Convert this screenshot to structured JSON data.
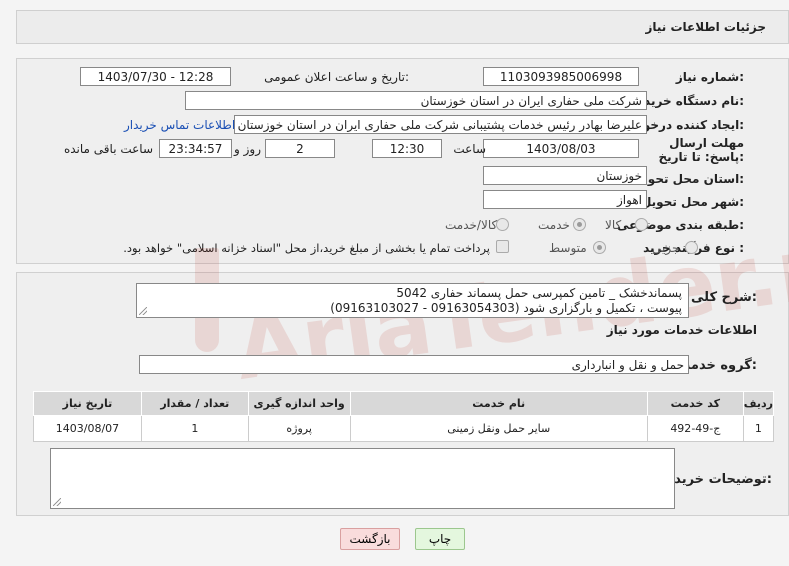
{
  "header": {
    "title": "جزئیات اطلاعات نیاز"
  },
  "need": {
    "number_label": "شماره نیاز:",
    "number": "1103093985006998",
    "announce_label": "تاریخ و ساعت اعلان عمومی:",
    "announce_value": "1403/07/30 - 12:28",
    "buyer_label": "نام دستگاه خریدار:",
    "buyer": "شرکت ملی حفاری ایران در استان خوزستان",
    "creator_label": "ایجاد کننده درخواست:",
    "creator": "علیرضا بهادر رئیس خدمات پشتیبانی شرکت ملی حفاری ایران در استان خوزستان",
    "contact_link": "اطلاعات تماس خریدار",
    "deadline_label": "مهلت ارسال پاسخ: تا تاریخ:",
    "deadline_date": "1403/08/03",
    "time_label": "ساعت",
    "deadline_time": "12:30",
    "days": "2",
    "days_label": "روز و",
    "remaining": "23:34:57",
    "remaining_label": "ساعت باقی مانده",
    "province_label": "استان محل تحویل:",
    "province": "خوزستان",
    "city_label": "شهر محل تحویل:",
    "city": "اهواز",
    "category_label": "طبقه بندی موضوعی:",
    "category_options": [
      "کالا",
      "خدمت",
      "کالا/خدمت"
    ],
    "category_selected": "خدمت",
    "process_label": "نوع فرآیند خرید :",
    "process_options": [
      "جزیی",
      "متوسط"
    ],
    "process_selected": "متوسط",
    "payment_note": "پرداخت تمام یا بخشی از مبلغ خرید،از محل \"اسناد خزانه اسلامی\" خواهد بود."
  },
  "summary": {
    "label": "شرح کلی نیاز:",
    "text": "پسماندخشک _ تامین کمپرسی حمل پسماند حفاری 5042\nپیوست ، تکمیل و بارگزاری شود (09163054303 - 09163103027)"
  },
  "services": {
    "section_title": "اطلاعات خدمات مورد نیاز",
    "group_label": "گروه خدمت:",
    "group_value": "حمل و نقل و انبارداری",
    "columns": [
      "ردیف",
      "کد خدمت",
      "نام خدمت",
      "واحد اندازه گیری",
      "تعداد / مقدار",
      "تاریخ نیاز"
    ],
    "rows": [
      [
        "1",
        "ج-49-492",
        "سایر حمل ونقل زمینی",
        "پروژه",
        "1",
        "1403/08/07"
      ]
    ]
  },
  "buyer_notes": {
    "label": "توضیحات خریدار:",
    "text": ""
  },
  "buttons": {
    "print": "چاپ",
    "back": "بازگشت"
  },
  "watermark": {
    "text": "AriaTender.neT"
  },
  "colors": {
    "link": "#1a4fb4",
    "back_button": "#f9dcdc",
    "print_button": "#e4f7de"
  }
}
